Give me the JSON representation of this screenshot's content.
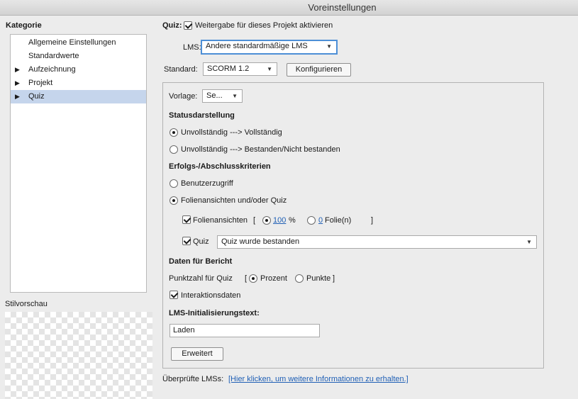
{
  "window": {
    "title": "Voreinstellungen"
  },
  "sidebar": {
    "heading": "Kategorie",
    "items": [
      {
        "label": "Allgemeine Einstellungen",
        "expandable": false
      },
      {
        "label": "Standardwerte",
        "expandable": false
      },
      {
        "label": "Aufzeichnung",
        "expandable": true
      },
      {
        "label": "Projekt",
        "expandable": true
      },
      {
        "label": "Quiz",
        "expandable": true,
        "selected": true
      }
    ],
    "style_preview_label": "Stilvorschau"
  },
  "main": {
    "quiz_label": "Quiz:",
    "enable_checkbox_label": "Weitergabe für dieses Projekt aktivieren",
    "lms_label": "LMS:",
    "lms_value": "Andere standardmäßige LMS",
    "standard_label": "Standard:",
    "standard_value": "SCORM 1.2",
    "configure_button": "Konfigurieren",
    "template_label": "Vorlage:",
    "template_value": "Se...",
    "status_heading": "Statusdarstellung",
    "status_option_1": "Unvollständig ---> Vollständig",
    "status_option_2": "Unvollständig ---> Bestanden/Nicht bestanden",
    "criteria_heading": "Erfolgs-/Abschlusskriterien",
    "criteria_option_1": "Benutzerzugriff",
    "criteria_option_2": "Folienansichten und/oder Quiz",
    "slide_views_label": "Folienansichten",
    "bracket_open": "[",
    "percent_value": "100",
    "percent_unit": "%",
    "slides_value": "0",
    "slides_unit": "Folie(n)",
    "bracket_close": "]",
    "quiz_checkbox_label": "Quiz",
    "quiz_condition_value": "Quiz wurde bestanden",
    "report_heading": "Daten für Bericht",
    "score_label": "Punktzahl für Quiz",
    "score_bracket_open": "[",
    "score_option_percent": "Prozent",
    "score_option_points": "Punkte",
    "score_bracket_close": "]",
    "interaction_data_label": "Interaktionsdaten",
    "init_text_heading": "LMS-Initialisierungstext:",
    "init_text_value": "Laden",
    "advanced_button": "Erweitert",
    "verified_lms_label": "Überprüfte LMSs:",
    "verified_lms_link": "[Hier klicken, um weitere Informationen zu erhalten.]"
  },
  "colors": {
    "selection": "#c5d5ec",
    "focus_ring": "#4d8fd6",
    "link": "#1f5fb5"
  }
}
